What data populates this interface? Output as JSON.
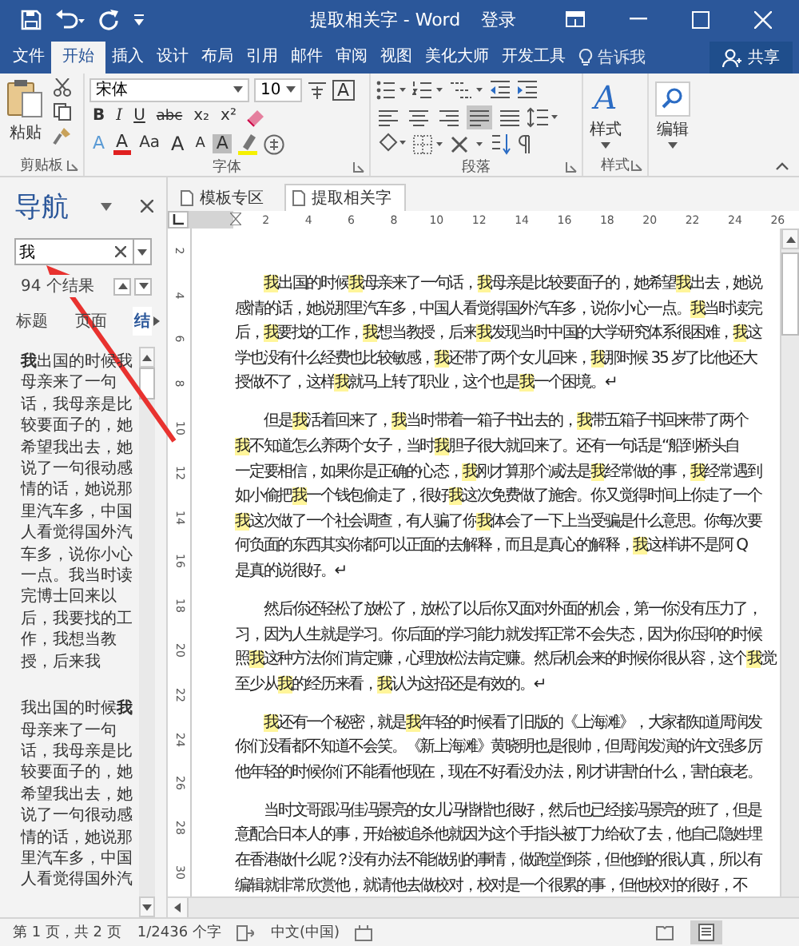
{
  "window": {
    "title": "提取相关字 - Word",
    "sign_in": "登录"
  },
  "menu_tabs": [
    {
      "label": "文件",
      "selected": false
    },
    {
      "label": "开始",
      "selected": true
    },
    {
      "label": "插入",
      "selected": false
    },
    {
      "label": "设计",
      "selected": false
    },
    {
      "label": "布局",
      "selected": false
    },
    {
      "label": "引用",
      "selected": false
    },
    {
      "label": "邮件",
      "selected": false
    },
    {
      "label": "审阅",
      "selected": false
    },
    {
      "label": "视图",
      "selected": false
    },
    {
      "label": "美化大师",
      "selected": false
    },
    {
      "label": "开发工具",
      "selected": false
    }
  ],
  "tell_me": "告诉我",
  "share": "共享",
  "ribbon": {
    "paste": "粘贴",
    "font_name": "宋体",
    "font_size": "10",
    "char_border": "A",
    "format_buttons": [
      {
        "label": "B",
        "kind": "bold"
      },
      {
        "label": "I",
        "kind": "italic"
      },
      {
        "label": "U",
        "kind": "underline"
      },
      {
        "label": "abc",
        "kind": "strike"
      },
      {
        "label": "x₂",
        "kind": "sub"
      },
      {
        "label": "x²",
        "kind": "sup"
      }
    ],
    "font_row3": [
      {
        "label": "A",
        "kind": "effects"
      },
      {
        "label": "A",
        "kind": "font-color"
      },
      {
        "label": "Aa",
        "kind": "case"
      },
      {
        "label": "A",
        "kind": "grow"
      },
      {
        "label": "A",
        "kind": "shrink"
      },
      {
        "label": "A",
        "kind": "shading"
      }
    ],
    "alignments": [
      {
        "kind": "left",
        "selected": false
      },
      {
        "kind": "center",
        "selected": false
      },
      {
        "kind": "right",
        "selected": false
      },
      {
        "kind": "justify",
        "selected": true
      },
      {
        "kind": "distributed",
        "selected": false
      }
    ],
    "styles_icon": "A",
    "styles": "样式",
    "editing": "编辑",
    "groups": [
      "剪贴板",
      "字体",
      "段落",
      "样式"
    ]
  },
  "navigation": {
    "title": "导航",
    "search": "我",
    "result_count": "94 个结果",
    "tabs": [
      {
        "label": "标题",
        "selected": false
      },
      {
        "label": "页面",
        "selected": false
      },
      {
        "label": "结",
        "selected": true
      }
    ],
    "results": [
      "**我**出国的时候我母亲来了一句话，我母亲是比较要面子的，她希望我出去，她说了一句很动感情的话，她说那里汽车多，中国人看觉得国外汽车多，说你小心一点。我当时读完博士回来以后，我要找的工作，我想当教授，后来我",
      "我出国的时候**我**母亲来了一句话，我母亲是比较要面子的，她希望我出去，她说了一句很动感情的话，她说那里汽车多，中国人看觉得国外汽"
    ]
  },
  "doc_tabs": [
    {
      "label": "模板专区",
      "selected": false
    },
    {
      "label": "提取相关字",
      "selected": true
    }
  ],
  "ruler_h": [
    "2",
    "4",
    "6",
    "8",
    "10",
    "12",
    "14",
    "16",
    "18",
    "20",
    "22",
    "24",
    "26"
  ],
  "ruler_v": [
    "2",
    "4",
    "6",
    "8",
    "10",
    "12",
    "14",
    "16",
    "18",
    "20",
    "22",
    "24",
    "26",
    "28",
    "30"
  ],
  "paragraphs": [
    {
      "lines": [
        [
          {
            "text": "我",
            "highlighted": true
          },
          {
            "text": "出国的时候",
            "highlighted": false
          },
          {
            "text": "我",
            "highlighted": true
          },
          {
            "text": "母亲来了一句话，",
            "highlighted": false
          },
          {
            "text": "我",
            "highlighted": true
          },
          {
            "text": "母亲是比较要面子的，她希望",
            "highlighted": false
          },
          {
            "text": "我",
            "highlighted": true
          },
          {
            "text": "出去，她说",
            "highlighted": false
          }
        ],
        [
          {
            "text": "感情的话，她说那里汽车多，中国人看觉得国外汽车多，说你小心一点。",
            "highlighted": false
          },
          {
            "text": "我",
            "highlighted": true
          },
          {
            "text": "当时读完",
            "highlighted": false
          }
        ],
        [
          {
            "text": "后，",
            "highlighted": false
          },
          {
            "text": "我",
            "highlighted": true
          },
          {
            "text": "要找的工作，",
            "highlighted": false
          },
          {
            "text": "我",
            "highlighted": true
          },
          {
            "text": "想当教授，后来",
            "highlighted": false
          },
          {
            "text": "我",
            "highlighted": true
          },
          {
            "text": "发现当时中国的大学研究体系很困难，",
            "highlighted": false
          },
          {
            "text": "我",
            "highlighted": true
          },
          {
            "text": "这",
            "highlighted": false
          }
        ],
        [
          {
            "text": "学也没有什么经费也比较敏感，",
            "highlighted": false
          },
          {
            "text": "我",
            "highlighted": true
          },
          {
            "text": "还带了两个女儿回来，",
            "highlighted": false
          },
          {
            "text": "我",
            "highlighted": true
          },
          {
            "text": "那时候 35 岁了比他还大",
            "highlighted": false
          }
        ],
        [
          {
            "text": "授做不了，这样",
            "highlighted": false
          },
          {
            "text": "我",
            "highlighted": true
          },
          {
            "text": "就马上转了职业，这个也是",
            "highlighted": false
          },
          {
            "text": "我",
            "highlighted": true
          },
          {
            "text": "一个困境。↵",
            "highlighted": false
          }
        ]
      ]
    },
    {
      "lines": [
        [
          {
            "text": "但是",
            "highlighted": false
          },
          {
            "text": "我",
            "highlighted": true
          },
          {
            "text": "活着回来了，",
            "highlighted": false
          },
          {
            "text": "我",
            "highlighted": true
          },
          {
            "text": "当时带着一箱子书出去的，",
            "highlighted": false
          },
          {
            "text": "我",
            "highlighted": true
          },
          {
            "text": "带五箱子书回来带了两个",
            "highlighted": false
          }
        ],
        [
          {
            "text": "我",
            "highlighted": true
          },
          {
            "text": "不知道怎么养两个女子，当时",
            "highlighted": false
          },
          {
            "text": "我",
            "highlighted": true
          },
          {
            "text": "胆子很大就回来了。还有一句话是“船到桥头自",
            "highlighted": false
          }
        ],
        [
          {
            "text": "一定要相信，如果你是正确的心态，",
            "highlighted": false
          },
          {
            "text": "我",
            "highlighted": true
          },
          {
            "text": "刚才算那个减法是",
            "highlighted": false
          },
          {
            "text": "我",
            "highlighted": true
          },
          {
            "text": "经常做的事，",
            "highlighted": false
          },
          {
            "text": "我",
            "highlighted": true
          },
          {
            "text": "经常遇到",
            "highlighted": false
          }
        ],
        [
          {
            "text": "如小偷把",
            "highlighted": false
          },
          {
            "text": "我",
            "highlighted": true
          },
          {
            "text": "一个钱包偷走了，很好",
            "highlighted": false
          },
          {
            "text": "我",
            "highlighted": true
          },
          {
            "text": "这次免费做了施舍。你又觉得时间上你走了一个",
            "highlighted": false
          }
        ],
        [
          {
            "text": "我",
            "highlighted": true
          },
          {
            "text": "这次做了一个社会调查，有人骗了你",
            "highlighted": false
          },
          {
            "text": "我",
            "highlighted": true
          },
          {
            "text": "体会了一下上当受骗是什么意思。你每次要",
            "highlighted": false
          }
        ],
        [
          {
            "text": "何负面的东西其实你都可以正面的去解释，而且是真心的解释，",
            "highlighted": false
          },
          {
            "text": "我",
            "highlighted": true
          },
          {
            "text": "这样讲不是阿 Q",
            "highlighted": false
          }
        ],
        [
          {
            "text": "是真的说很好。↵",
            "highlighted": false
          }
        ]
      ]
    },
    {
      "lines": [
        [
          {
            "text": "然后你还轻松了放松了，放松了以后你又面对外面的机会，第一你没有压力了，",
            "highlighted": false
          }
        ],
        [
          {
            "text": "习，因为人生就是学习。你后面的学习能力就发挥正常不会失态，因为你压抑的时候",
            "highlighted": false
          }
        ],
        [
          {
            "text": "照",
            "highlighted": false
          },
          {
            "text": "我",
            "highlighted": true
          },
          {
            "text": "这种方法你们肯定赚，心理放松法肯定赚。然后机会来的时候你很从容，这个",
            "highlighted": false
          },
          {
            "text": "我",
            "highlighted": true
          },
          {
            "text": "觉",
            "highlighted": false
          }
        ],
        [
          {
            "text": "至少从",
            "highlighted": false
          },
          {
            "text": "我",
            "highlighted": true
          },
          {
            "text": "的经历来看，",
            "highlighted": false
          },
          {
            "text": "我",
            "highlighted": true
          },
          {
            "text": "认为这招还是有效的。↵",
            "highlighted": false
          }
        ]
      ]
    },
    {
      "lines": [
        [
          {
            "text": "我",
            "highlighted": true
          },
          {
            "text": "还有一个秘密，就是",
            "highlighted": false
          },
          {
            "text": "我",
            "highlighted": true
          },
          {
            "text": "年轻的时候看了旧版的《上海滩》，大家都知道周润发",
            "highlighted": false
          }
        ],
        [
          {
            "text": "你们没看都不知道不会笑。《新上海滩》黄晓明也是很帅，但周润发演的许文强多厉",
            "highlighted": false
          }
        ],
        [
          {
            "text": "他年轻的时候你们不能看他现在，现在不好看没办法，刚才讲害怕什么，害怕衰老。",
            "highlighted": false
          }
        ]
      ]
    },
    {
      "lines": [
        [
          {
            "text": "当时文哥跟冯佳冯景亮的女儿冯楷楷也很好，然后也已经接冯景亮的班了，但是",
            "highlighted": false
          }
        ],
        [
          {
            "text": "意配合日本人的事，开始被追杀他就因为这个手指头被丁力给砍了去，他自己隐姓埋",
            "highlighted": false
          }
        ],
        [
          {
            "text": "在香港做什么呢？没有办法不能做别的事情，做跑堂倒茶，但他倒的很认真，所以有",
            "highlighted": false
          }
        ],
        [
          {
            "text": "编辑就非常欣赏他，就请他去做校对，校对是一个很累的事，但他校对的很好，不",
            "highlighted": false
          }
        ]
      ]
    }
  ],
  "status_bar": {
    "page": "第 1 页，共 2 页",
    "words": "1/2436 个字",
    "language": "中文(中国)"
  }
}
